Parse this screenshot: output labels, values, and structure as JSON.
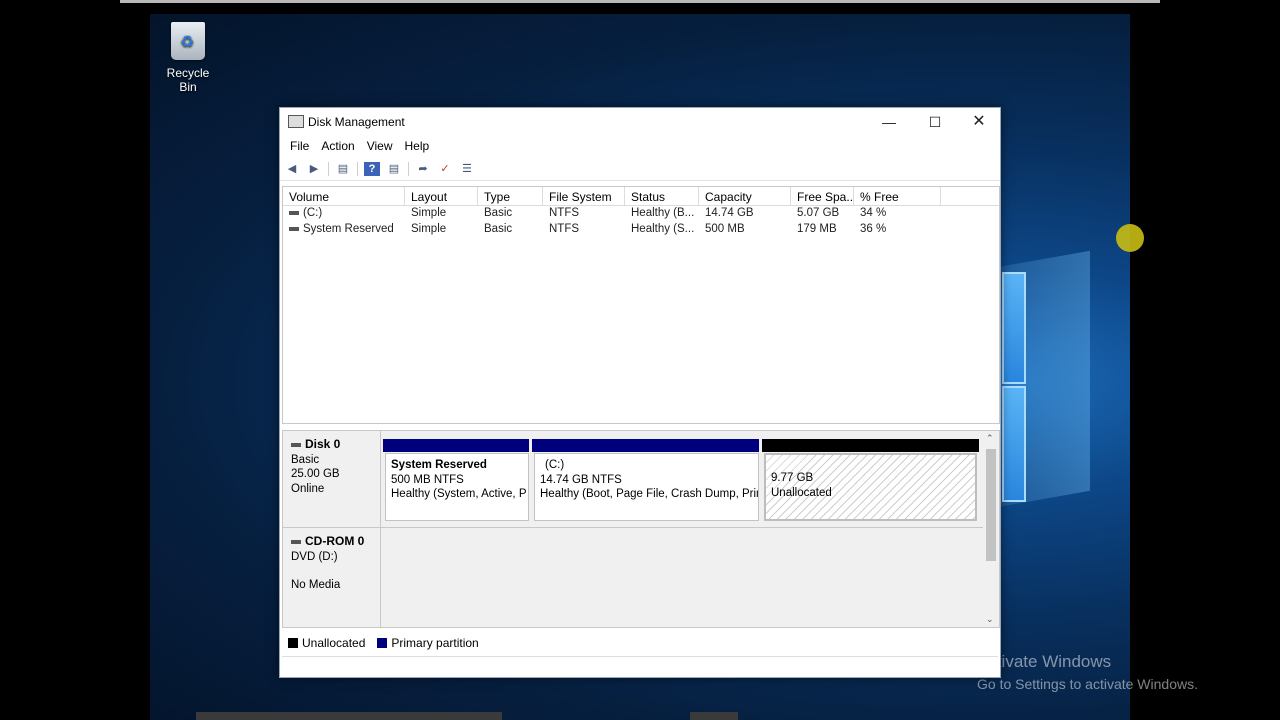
{
  "desktop": {
    "recycle_bin_label": "Recycle Bin",
    "activate_title": "Activate Windows",
    "activate_sub": "Go to Settings to activate Windows."
  },
  "window": {
    "title": "Disk Management",
    "menu": [
      "File",
      "Action",
      "View",
      "Help"
    ],
    "columns": [
      "Volume",
      "Layout",
      "Type",
      "File System",
      "Status",
      "Capacity",
      "Free Spa...",
      "% Free"
    ],
    "volumes": [
      {
        "volume": "(C:)",
        "layout": "Simple",
        "type": "Basic",
        "fs": "NTFS",
        "status": "Healthy (B...",
        "capacity": "14.74 GB",
        "free": "5.07 GB",
        "pct": "34 %"
      },
      {
        "volume": "System Reserved",
        "layout": "Simple",
        "type": "Basic",
        "fs": "NTFS",
        "status": "Healthy (S...",
        "capacity": "500 MB",
        "free": "179 MB",
        "pct": "36 %"
      }
    ],
    "disks": [
      {
        "name": "Disk 0",
        "type": "Basic",
        "size": "25.00 GB",
        "state": "Online",
        "partitions": [
          {
            "title": "System Reserved",
            "size": "500 MB NTFS",
            "status": "Healthy (System, Active, P"
          },
          {
            "title": "(C:)",
            "size": "14.74 GB NTFS",
            "status": "Healthy (Boot, Page File, Crash Dump, Prin"
          },
          {
            "title": "",
            "size": "9.77 GB",
            "status": "Unallocated"
          }
        ]
      },
      {
        "name": "CD-ROM 0",
        "type": "DVD (D:)",
        "size": "",
        "state": "No Media"
      }
    ],
    "legend": [
      "Unallocated",
      "Primary partition"
    ],
    "colors": {
      "primary": "#00007f",
      "unallocated": "#000000"
    }
  }
}
